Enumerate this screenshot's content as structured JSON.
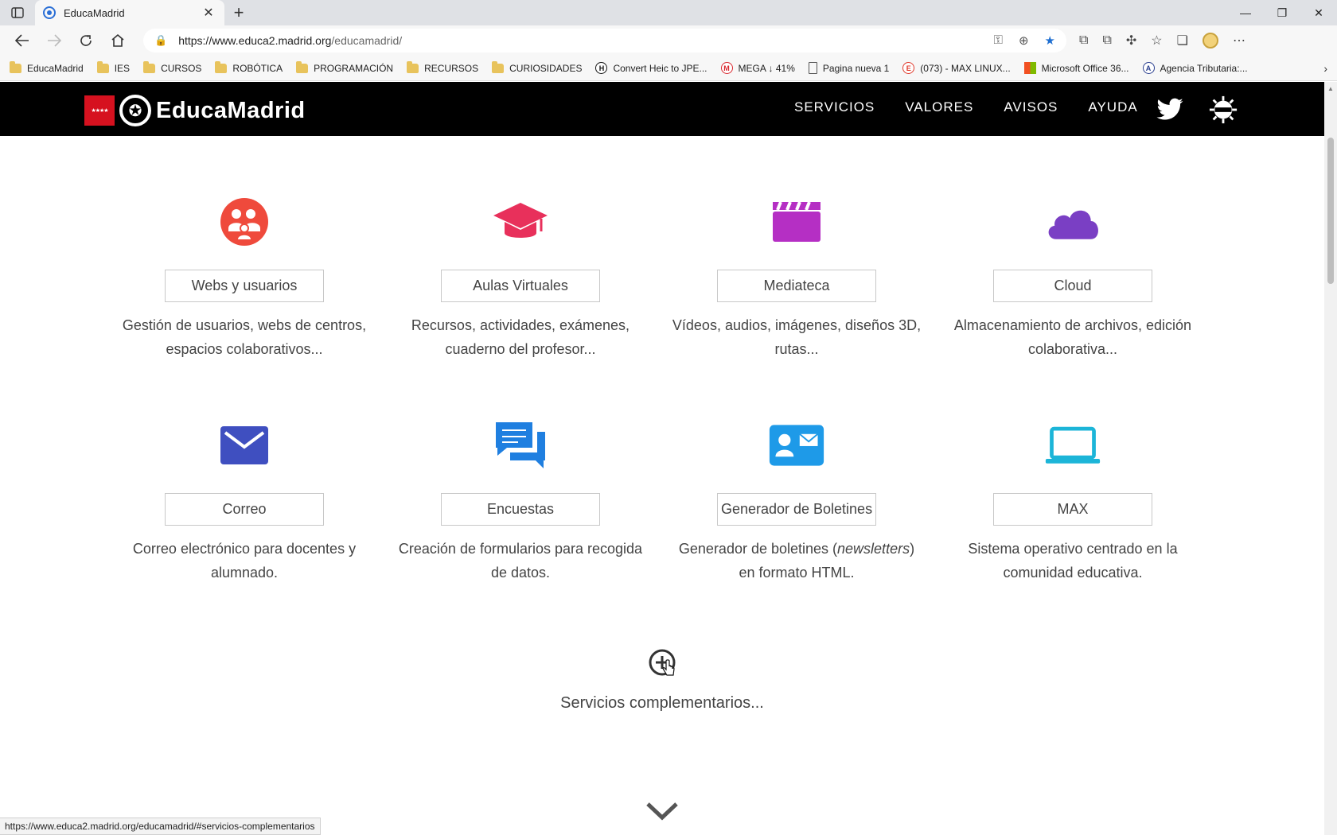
{
  "browser": {
    "tab_title": "EducaMadrid",
    "tab_close": "✕",
    "new_tab": "+",
    "win_min": "—",
    "win_restore": "❐",
    "win_close": "✕",
    "url_host": "https://www.educa2.madrid.org",
    "url_path": "/educamadrid/",
    "bookmarks": [
      {
        "label": "EducaMadrid",
        "type": "folder"
      },
      {
        "label": "IES",
        "type": "folder"
      },
      {
        "label": "CURSOS",
        "type": "folder"
      },
      {
        "label": "ROBÓTICA",
        "type": "folder"
      },
      {
        "label": "PROGRAMACIÓN",
        "type": "folder"
      },
      {
        "label": "RECURSOS",
        "type": "folder"
      },
      {
        "label": "CURIOSIDADES",
        "type": "folder"
      },
      {
        "label": "Convert Heic to JPE...",
        "type": "site",
        "icon_text": "H",
        "color": "#111111"
      },
      {
        "label": "MEGA ↓ 41%",
        "type": "site",
        "icon_text": "M",
        "color": "#d9272e"
      },
      {
        "label": "Pagina nueva 1",
        "type": "page"
      },
      {
        "label": "(073) - MAX LINUX...",
        "type": "site",
        "icon_text": "E",
        "color": "#e0392b"
      },
      {
        "label": "Microsoft Office 36...",
        "type": "ms"
      },
      {
        "label": "Agencia Tributaria:...",
        "type": "site",
        "icon_text": "A",
        "color": "#2a3f8f"
      }
    ],
    "status_url": "https://www.educa2.madrid.org/educamadrid/#servicios-complementarios"
  },
  "site": {
    "brand": "EducaMadrid",
    "flag_stars": "★★★★",
    "nav": [
      "SERVICIOS",
      "VALORES",
      "AVISOS",
      "AYUDA"
    ],
    "colors": {
      "header_bg": "#000000",
      "webs": "#ef4a3c",
      "aulas": "#e8305b",
      "mediateca": "#b52fc4",
      "cloud": "#7a3fc4",
      "correo": "#3f4fc0",
      "encuestas": "#1f7fe0",
      "boletines": "#1e9ae8",
      "max": "#1cb5d8"
    },
    "services": [
      {
        "icon": "users-icon",
        "label": "Webs y usuarios",
        "desc": "Gestión de usuarios, webs de centros, espacios colaborativos..."
      },
      {
        "icon": "graduation-cap-icon",
        "label": "Aulas Virtuales",
        "desc": "Recursos, actividades, exámenes, cuaderno del profesor..."
      },
      {
        "icon": "clapperboard-icon",
        "label": "Mediateca",
        "desc": "Vídeos, audios, imágenes, diseños 3D, rutas..."
      },
      {
        "icon": "cloud-icon",
        "label": "Cloud",
        "desc": "Almacenamiento de archivos, edición colaborativa..."
      },
      {
        "icon": "envelope-icon",
        "label": "Correo",
        "desc": "Correo electrónico para docentes y alumnado."
      },
      {
        "icon": "chat-bubbles-icon",
        "label": "Encuestas",
        "desc": "Creación de formularios para recogida de datos."
      },
      {
        "icon": "contact-card-icon",
        "label": "Generador de Boletines",
        "desc_before": "Generador de boletines (",
        "desc_em": "newsletters",
        "desc_after": ") en formato HTML."
      },
      {
        "icon": "laptop-icon",
        "label": "MAX",
        "desc": "Sistema operativo centrado en la comunidad educativa."
      }
    ],
    "complementary_label": "Servicios complementarios..."
  }
}
